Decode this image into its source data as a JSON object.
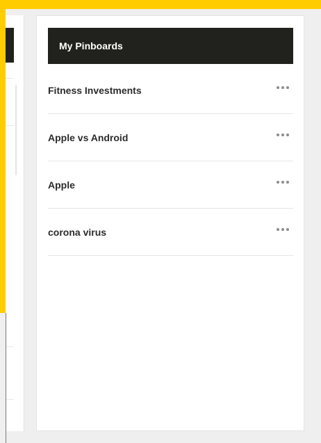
{
  "pinboards": {
    "title": "My Pinboards",
    "items": [
      {
        "label": "Fitness Investments",
        "menu_icon": "more-horizontal-icon"
      },
      {
        "label": "Apple vs Android",
        "menu_icon": "more-horizontal-icon"
      },
      {
        "label": "Apple",
        "menu_icon": "more-horizontal-icon"
      },
      {
        "label": "corona virus",
        "menu_icon": "more-horizontal-icon"
      }
    ]
  },
  "colors": {
    "brand_yellow": "#ffcc00",
    "header_bg": "#21221d",
    "page_bg": "#efefef"
  }
}
